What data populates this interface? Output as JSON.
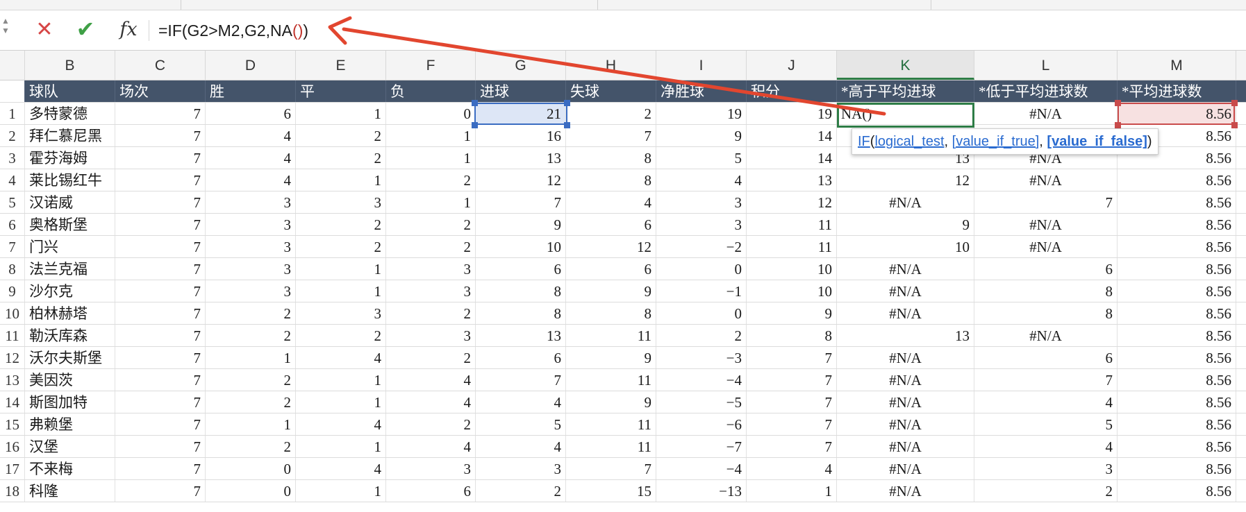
{
  "formula_bar": {
    "cancel_icon": "cancel-x-icon",
    "enter_icon": "enter-check-icon",
    "fx_label": "fx",
    "formula_prefix": "=IF(G2>M2,G2,NA",
    "formula_open_paren": "(",
    "formula_close_paren": ")",
    "formula_suffix": ")"
  },
  "columns": [
    "B",
    "C",
    "D",
    "E",
    "F",
    "G",
    "H",
    "I",
    "J",
    "K",
    "L",
    "M"
  ],
  "active_column": "K",
  "header_row": {
    "row_number": "",
    "cells": [
      "球队",
      "场次",
      "胜",
      "平",
      "负",
      "进球",
      "失球",
      "净胜球",
      "积分",
      "*高于平均进球",
      "*低于平均进球数",
      "*平均进球数"
    ]
  },
  "rows": [
    {
      "n": "1",
      "team": "多特蒙德",
      "vals": [
        "7",
        "6",
        "1",
        "0",
        "21",
        "2",
        "19",
        "19"
      ],
      "k": "NA()",
      "l": "#N/A",
      "m": "8.56"
    },
    {
      "n": "2",
      "team": "拜仁慕尼黑",
      "vals": [
        "7",
        "4",
        "2",
        "1",
        "16",
        "7",
        "9",
        "14"
      ],
      "k": "",
      "l": "",
      "m": "8.56"
    },
    {
      "n": "3",
      "team": "霍芬海姆",
      "vals": [
        "7",
        "4",
        "2",
        "1",
        "13",
        "8",
        "5",
        "14"
      ],
      "k": "13",
      "l": "#N/A",
      "m": "8.56"
    },
    {
      "n": "4",
      "team": "莱比锡红牛",
      "vals": [
        "7",
        "4",
        "1",
        "2",
        "12",
        "8",
        "4",
        "13"
      ],
      "k": "12",
      "l": "#N/A",
      "m": "8.56"
    },
    {
      "n": "5",
      "team": "汉诺威",
      "vals": [
        "7",
        "3",
        "3",
        "1",
        "7",
        "4",
        "3",
        "12"
      ],
      "k": "#N/A",
      "l": "7",
      "m": "8.56"
    },
    {
      "n": "6",
      "team": "奥格斯堡",
      "vals": [
        "7",
        "3",
        "2",
        "2",
        "9",
        "6",
        "3",
        "11"
      ],
      "k": "9",
      "l": "#N/A",
      "m": "8.56"
    },
    {
      "n": "7",
      "team": "门兴",
      "vals": [
        "7",
        "3",
        "2",
        "2",
        "10",
        "12",
        "−2",
        "11"
      ],
      "k": "10",
      "l": "#N/A",
      "m": "8.56"
    },
    {
      "n": "8",
      "team": "法兰克福",
      "vals": [
        "7",
        "3",
        "1",
        "3",
        "6",
        "6",
        "0",
        "10"
      ],
      "k": "#N/A",
      "l": "6",
      "m": "8.56"
    },
    {
      "n": "9",
      "team": "沙尔克",
      "vals": [
        "7",
        "3",
        "1",
        "3",
        "8",
        "9",
        "−1",
        "10"
      ],
      "k": "#N/A",
      "l": "8",
      "m": "8.56"
    },
    {
      "n": "10",
      "team": "柏林赫塔",
      "vals": [
        "7",
        "2",
        "3",
        "2",
        "8",
        "8",
        "0",
        "9"
      ],
      "k": "#N/A",
      "l": "8",
      "m": "8.56"
    },
    {
      "n": "11",
      "team": "勒沃库森",
      "vals": [
        "7",
        "2",
        "2",
        "3",
        "13",
        "11",
        "2",
        "8"
      ],
      "k": "13",
      "l": "#N/A",
      "m": "8.56"
    },
    {
      "n": "12",
      "team": "沃尔夫斯堡",
      "vals": [
        "7",
        "1",
        "4",
        "2",
        "6",
        "9",
        "−3",
        "7"
      ],
      "k": "#N/A",
      "l": "6",
      "m": "8.56"
    },
    {
      "n": "13",
      "team": "美因茨",
      "vals": [
        "7",
        "2",
        "1",
        "4",
        "7",
        "11",
        "−4",
        "7"
      ],
      "k": "#N/A",
      "l": "7",
      "m": "8.56"
    },
    {
      "n": "14",
      "team": "斯图加特",
      "vals": [
        "7",
        "2",
        "1",
        "4",
        "4",
        "9",
        "−5",
        "7"
      ],
      "k": "#N/A",
      "l": "4",
      "m": "8.56"
    },
    {
      "n": "15",
      "team": "弗赖堡",
      "vals": [
        "7",
        "1",
        "4",
        "2",
        "5",
        "11",
        "−6",
        "7"
      ],
      "k": "#N/A",
      "l": "5",
      "m": "8.56"
    },
    {
      "n": "16",
      "team": "汉堡",
      "vals": [
        "7",
        "2",
        "1",
        "4",
        "4",
        "11",
        "−7",
        "7"
      ],
      "k": "#N/A",
      "l": "4",
      "m": "8.56"
    },
    {
      "n": "17",
      "team": "不来梅",
      "vals": [
        "7",
        "0",
        "4",
        "3",
        "3",
        "7",
        "−4",
        "4"
      ],
      "k": "#N/A",
      "l": "3",
      "m": "8.56"
    },
    {
      "n": "18",
      "team": "科隆",
      "vals": [
        "7",
        "0",
        "1",
        "6",
        "2",
        "15",
        "−13",
        "1"
      ],
      "k": "#N/A",
      "l": "2",
      "m": "8.56"
    }
  ],
  "tooltip": {
    "fn": "IF",
    "open": "(",
    "arg1": "logical_test",
    "sep1": ", ",
    "arg2": "[value_if_true]",
    "sep2": ", ",
    "arg3": "[value_if_false]",
    "close": ")"
  },
  "colors": {
    "header_fill": "#44546a",
    "selection_blue": "#3a6cc2",
    "selection_red": "#c94b4b",
    "active_green": "#2e7d46",
    "arrow_red": "#e2462f"
  }
}
